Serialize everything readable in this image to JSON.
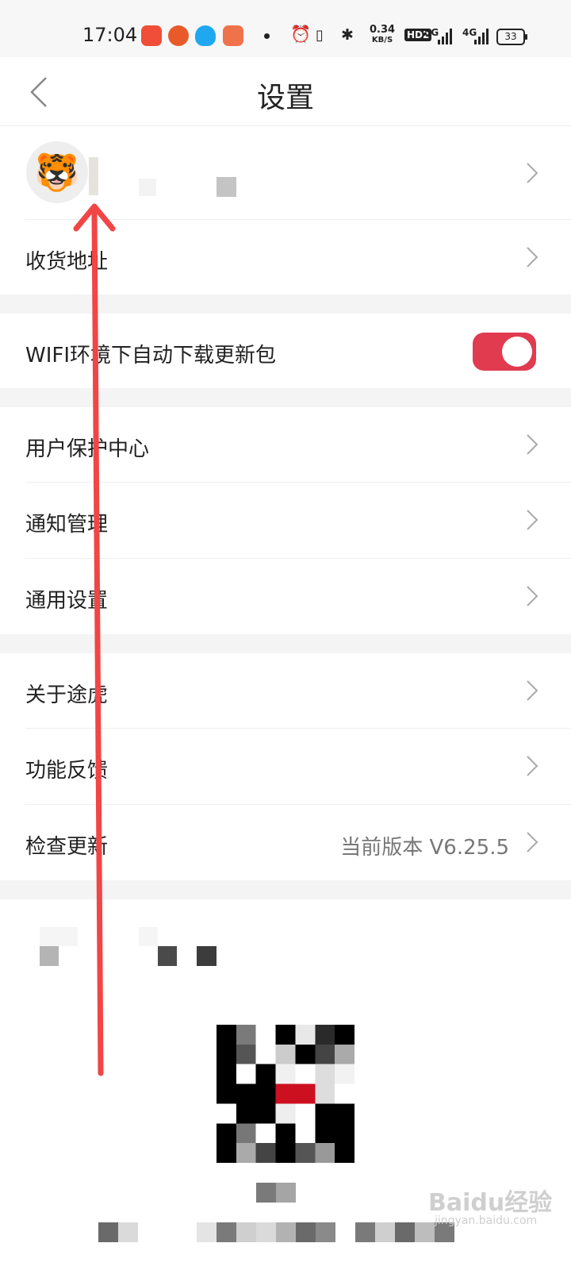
{
  "status_bar": {
    "time": "17:04",
    "net_speed_value": "0.34",
    "net_speed_unit": "KB/S",
    "hd_label": "HD2",
    "sig1_label": "5G",
    "sig2_label": "4G",
    "battery": "33",
    "app_icons": [
      "weibo-icon",
      "game-icon",
      "qq-icon",
      "app-icon"
    ],
    "colors": {
      "weibo": "#f04e38",
      "game": "#e85a2a",
      "qq": "#1fa8f0",
      "app": "#f0724a"
    }
  },
  "header": {
    "title": "设置"
  },
  "profile": {
    "avatar_icon": "tiger-avatar-icon",
    "avatar_emoji": "🐯"
  },
  "menu": {
    "address": "收货地址",
    "wifi_toggle": "WIFI环境下自动下载更新包",
    "wifi_toggle_on": true,
    "user_protection": "用户保护中心",
    "notifications": "通知管理",
    "general": "通用设置",
    "about": "关于途虎",
    "feedback": "功能反馈",
    "check_update": "检查更新",
    "current_version": "当前版本 V6.25.5"
  },
  "watermark": {
    "text": "Baidu经验",
    "sub": "jingyan.baidu.com"
  },
  "colors": {
    "accent": "#e13b50",
    "annotation_arrow": "#f24545"
  }
}
